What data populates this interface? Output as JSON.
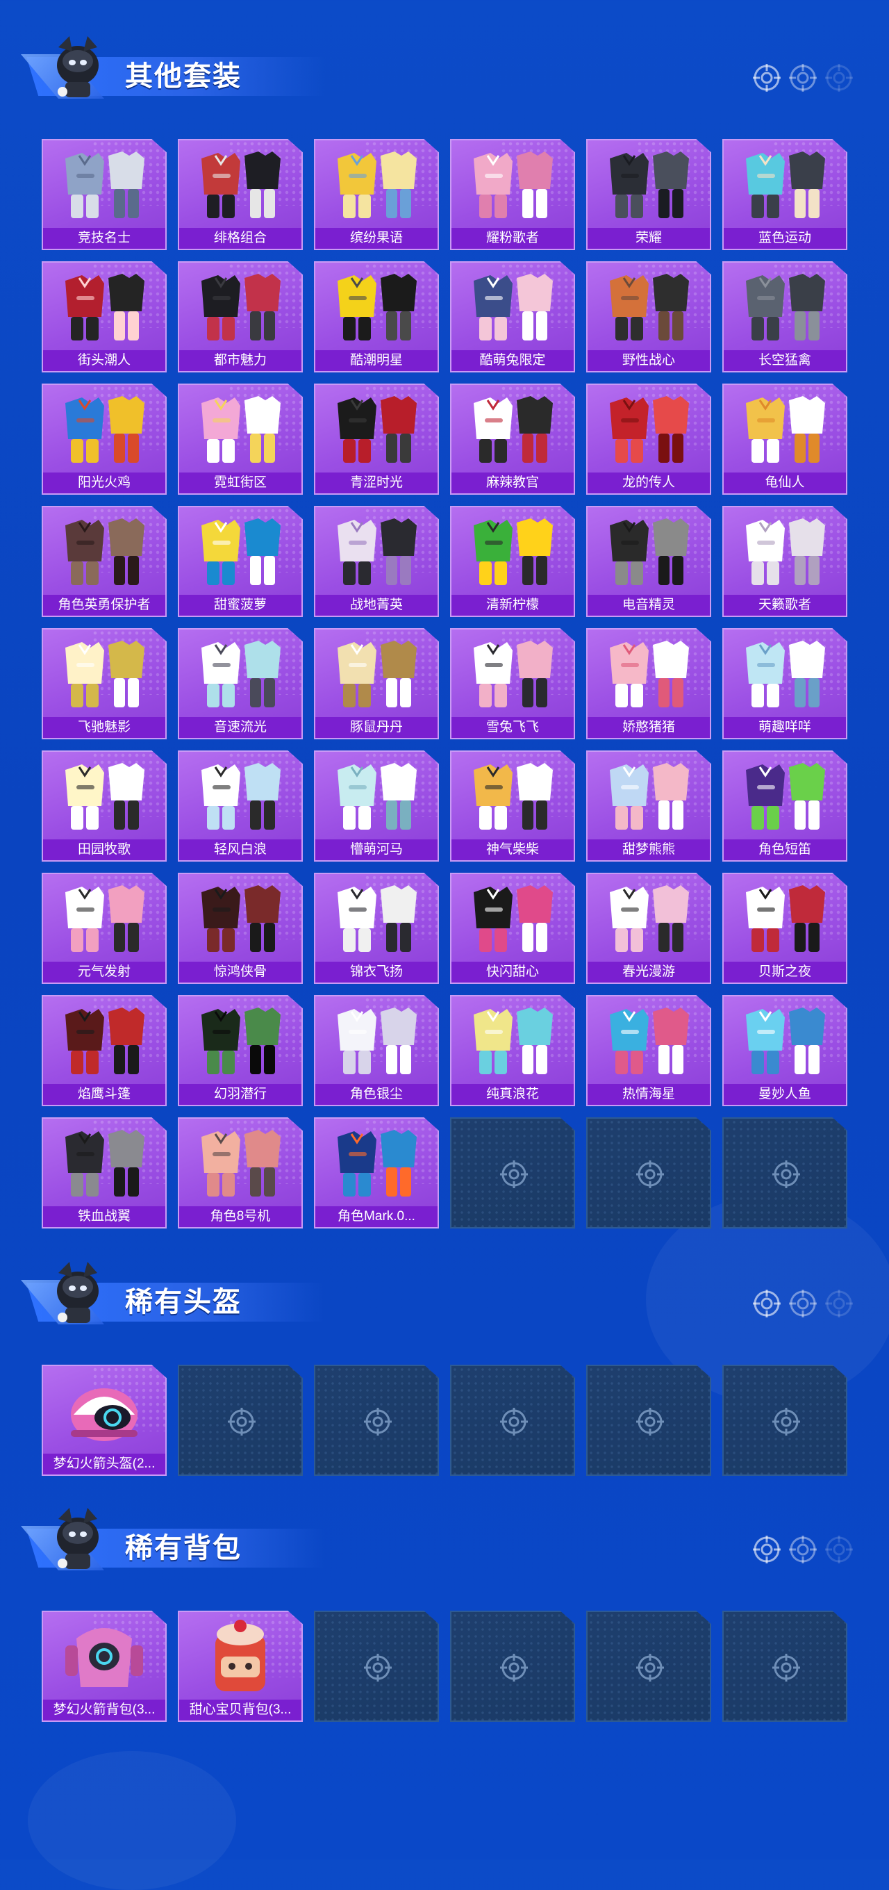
{
  "sections": [
    {
      "title": "其他套装",
      "items": [
        {
          "label": "竞技名士",
          "icon": "outfit-icon"
        },
        {
          "label": "绯格组合",
          "icon": "outfit-icon"
        },
        {
          "label": "缤纷果语",
          "icon": "outfit-icon"
        },
        {
          "label": "耀粉歌者",
          "icon": "outfit-icon"
        },
        {
          "label": "荣耀",
          "icon": "outfit-icon"
        },
        {
          "label": "蓝色运动",
          "icon": "outfit-icon"
        },
        {
          "label": "街头潮人",
          "icon": "outfit-icon"
        },
        {
          "label": "都市魅力",
          "icon": "outfit-icon"
        },
        {
          "label": "酷潮明星",
          "icon": "outfit-icon"
        },
        {
          "label": "酷萌兔限定",
          "icon": "outfit-icon"
        },
        {
          "label": "野性战心",
          "icon": "outfit-icon"
        },
        {
          "label": "长空猛禽",
          "icon": "outfit-icon"
        },
        {
          "label": "阳光火鸡",
          "icon": "outfit-icon"
        },
        {
          "label": "霓虹街区",
          "icon": "outfit-icon"
        },
        {
          "label": "青涩时光",
          "icon": "outfit-icon"
        },
        {
          "label": "麻辣教官",
          "icon": "outfit-icon"
        },
        {
          "label": "龙的传人",
          "icon": "outfit-icon"
        },
        {
          "label": "龟仙人",
          "icon": "outfit-icon"
        },
        {
          "label": "角色英勇保护者",
          "icon": "outfit-icon"
        },
        {
          "label": "甜蜜菠萝",
          "icon": "outfit-icon"
        },
        {
          "label": "战地菁英",
          "icon": "outfit-icon"
        },
        {
          "label": "清新柠檬",
          "icon": "outfit-icon"
        },
        {
          "label": "电音精灵",
          "icon": "outfit-icon"
        },
        {
          "label": "天籁歌者",
          "icon": "outfit-icon"
        },
        {
          "label": "飞驰魅影",
          "icon": "outfit-icon"
        },
        {
          "label": "音速流光",
          "icon": "outfit-icon"
        },
        {
          "label": "豚鼠丹丹",
          "icon": "outfit-icon"
        },
        {
          "label": "雪兔飞飞",
          "icon": "outfit-icon"
        },
        {
          "label": "娇憨猪猪",
          "icon": "outfit-icon"
        },
        {
          "label": "萌趣咩咩",
          "icon": "outfit-icon"
        },
        {
          "label": "田园牧歌",
          "icon": "outfit-icon"
        },
        {
          "label": "轻风白浪",
          "icon": "outfit-icon"
        },
        {
          "label": "懵萌河马",
          "icon": "outfit-icon"
        },
        {
          "label": "神气柴柴",
          "icon": "outfit-icon"
        },
        {
          "label": "甜梦熊熊",
          "icon": "outfit-icon"
        },
        {
          "label": "角色短笛",
          "icon": "outfit-icon"
        },
        {
          "label": "元气发射",
          "icon": "outfit-icon"
        },
        {
          "label": "惊鸿侠骨",
          "icon": "outfit-icon"
        },
        {
          "label": "锦衣飞扬",
          "icon": "outfit-icon"
        },
        {
          "label": "快闪甜心",
          "icon": "outfit-icon"
        },
        {
          "label": "春光漫游",
          "icon": "outfit-icon"
        },
        {
          "label": "贝斯之夜",
          "icon": "outfit-icon"
        },
        {
          "label": "焰鹰斗篷",
          "icon": "outfit-icon"
        },
        {
          "label": "幻羽潜行",
          "icon": "outfit-icon"
        },
        {
          "label": "角色银尘",
          "icon": "outfit-icon"
        },
        {
          "label": "纯真浪花",
          "icon": "outfit-icon"
        },
        {
          "label": "热情海星",
          "icon": "outfit-icon"
        },
        {
          "label": "曼妙人鱼",
          "icon": "outfit-icon"
        },
        {
          "label": "铁血战翼",
          "icon": "outfit-icon"
        },
        {
          "label": "角色8号机",
          "icon": "outfit-icon"
        },
        {
          "label": "角色Mark.0...",
          "icon": "outfit-icon"
        }
      ],
      "empty_slots": 3
    },
    {
      "title": "稀有头盔",
      "items": [
        {
          "label": "梦幻火箭头盔(2...",
          "icon": "helmet-icon"
        }
      ],
      "empty_slots": 5
    },
    {
      "title": "稀有背包",
      "items": [
        {
          "label": "梦幻火箭背包(3...",
          "icon": "backpack-icon"
        },
        {
          "label": "甜心宝贝背包(3...",
          "icon": "backpack-icon"
        }
      ],
      "empty_slots": 4
    }
  ],
  "colors": {
    "background": "#0a44c0",
    "card_purple": "#9b4fe4",
    "label_bar": "#7a1fd0",
    "empty_slot": "#1a3a66"
  }
}
